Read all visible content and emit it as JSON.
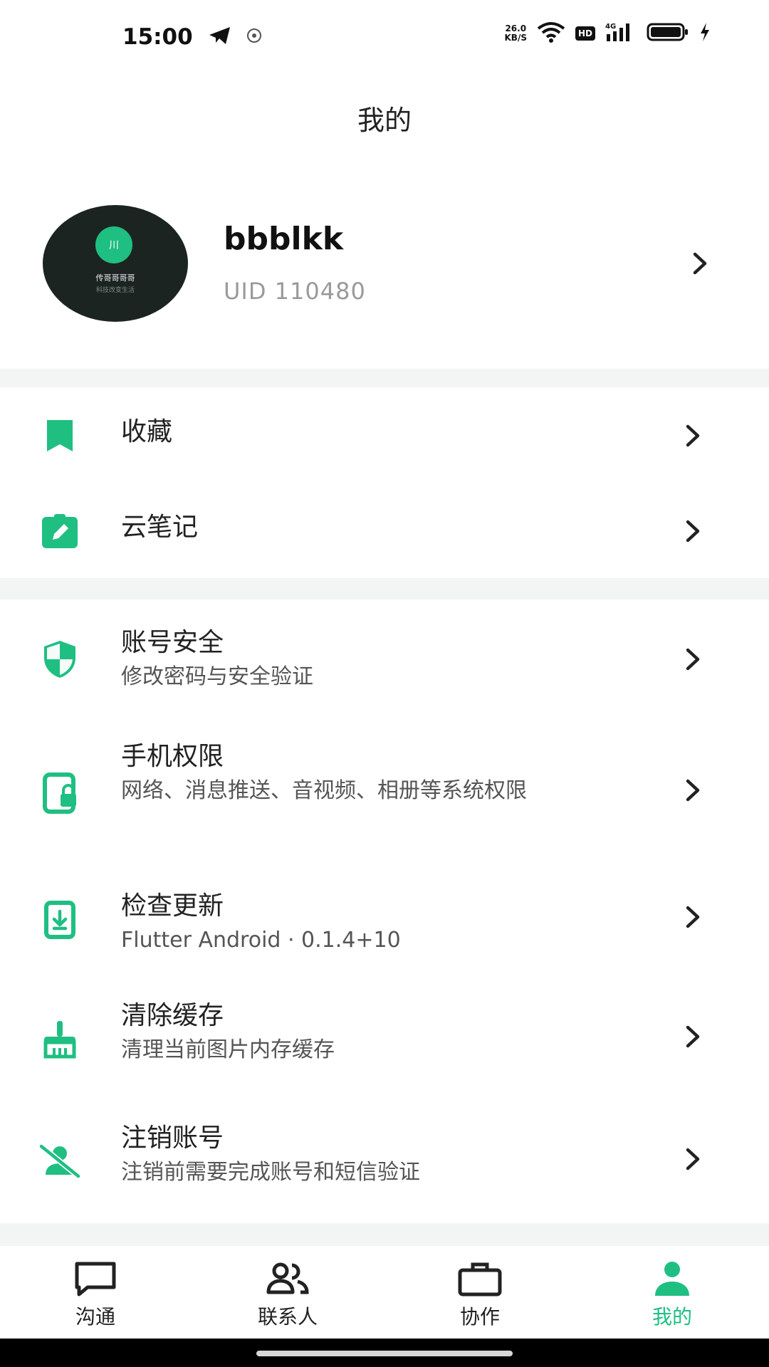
{
  "status_bar": {
    "time": "15:00",
    "speed_value": "26.0",
    "speed_unit": "KB/S",
    "hd_label": "HD",
    "net_label": "4G",
    "icons": [
      "telegram-icon",
      "app-notification-icon",
      "wifi-icon",
      "signal-icon",
      "battery-icon",
      "charging-icon"
    ]
  },
  "header": {
    "title": "我的"
  },
  "profile": {
    "name": "bbblkk",
    "uid": "UID 110480",
    "avatar": {
      "badge": "川",
      "line1": "传哥哥哥哥",
      "line2": "科技改变生活"
    }
  },
  "menu": {
    "group1": [
      {
        "title": "收藏",
        "icon": "bookmark-icon"
      },
      {
        "title": "云笔记",
        "icon": "clipboard-edit-icon"
      }
    ],
    "group2": [
      {
        "title": "账号安全",
        "subtitle": "修改密码与安全验证",
        "icon": "shield-icon"
      },
      {
        "title": "手机权限",
        "subtitle": "网络、消息推送、音视频、相册等系统权限",
        "icon": "phone-lock-icon"
      },
      {
        "title": "检查更新",
        "subtitle": "Flutter Android · 0.1.4+10",
        "icon": "download-icon"
      },
      {
        "title": "清除缓存",
        "subtitle": "清理当前图片内存缓存",
        "icon": "broom-icon"
      },
      {
        "title": "注销账号",
        "subtitle": "注销前需要完成账号和短信验证",
        "icon": "user-off-icon"
      }
    ]
  },
  "tabs": [
    {
      "label": "沟通",
      "icon": "chat-icon"
    },
    {
      "label": "联系人",
      "icon": "contacts-icon"
    },
    {
      "label": "协作",
      "icon": "briefcase-icon"
    },
    {
      "label": "我的",
      "icon": "person-icon",
      "active": true
    }
  ],
  "colors": {
    "accent": "#1fbf82",
    "text": "#222222",
    "muted": "#9a9a9a",
    "divider": "#f3f4f4"
  }
}
